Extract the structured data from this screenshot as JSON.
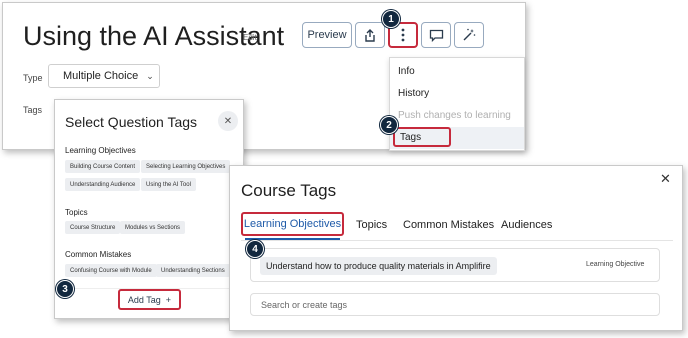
{
  "main": {
    "title": "Using the AI Assistant",
    "edit_label": "Edit",
    "toolbar": {
      "preview_label": "Preview",
      "share_icon": "share-icon",
      "more_icon": "vertical-dots-icon",
      "comment_icon": "comment-icon",
      "magic_icon": "magic-wand-icon"
    },
    "type_label": "Type",
    "type_value": "Multiple Choice",
    "tags_label": "Tags"
  },
  "menu": {
    "items": [
      "Info",
      "History",
      "Push changes to learning",
      "Tags"
    ]
  },
  "select_tags": {
    "title": "Select Question Tags",
    "sections": [
      {
        "heading": "Learning Objectives",
        "chips": [
          "Building Course Content",
          "Selecting Learning Objectives",
          "Understanding Audience",
          "Using the AI Tool"
        ]
      },
      {
        "heading": "Topics",
        "chips": [
          "Course Structure",
          "Modules vs Sections"
        ]
      },
      {
        "heading": "Common Mistakes",
        "chips": [
          "Confusing Course with Module",
          "Understanding Sections"
        ]
      }
    ],
    "add_tag_label": "Add Tag",
    "add_tag_icon": "+"
  },
  "course_tags": {
    "title": "Course Tags",
    "close_icon": "✕",
    "tabs": [
      "Learning Objectives",
      "Topics",
      "Common Mistakes",
      "Audiences"
    ],
    "active_tab": "Learning Objectives",
    "tag_item": {
      "label": "Understand how to produce quality materials in Amplifire",
      "type": "Learning Objective"
    },
    "search_placeholder": "Search or create tags"
  },
  "badges": [
    "1",
    "2",
    "3",
    "4"
  ],
  "colors": {
    "highlight": "#c62a3c",
    "badge": "#12283f",
    "accent": "#1e5aa8"
  }
}
